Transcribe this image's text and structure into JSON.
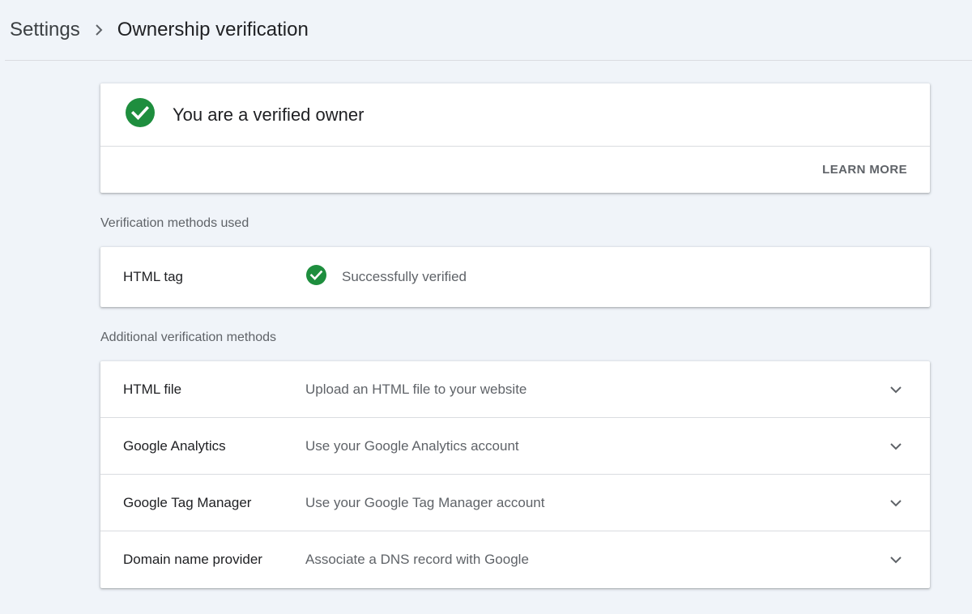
{
  "breadcrumb": {
    "parent": "Settings",
    "current": "Ownership verification"
  },
  "owner_card": {
    "title": "You are a verified owner",
    "action": "LEARN MORE"
  },
  "used_section": {
    "label": "Verification methods used",
    "methods": [
      {
        "name": "HTML tag",
        "status": "Successfully verified"
      }
    ]
  },
  "additional_section": {
    "label": "Additional verification methods",
    "methods": [
      {
        "name": "HTML file",
        "description": "Upload an HTML file to your website"
      },
      {
        "name": "Google Analytics",
        "description": "Use your Google Analytics account"
      },
      {
        "name": "Google Tag Manager",
        "description": "Use your Google Tag Manager account"
      },
      {
        "name": "Domain name provider",
        "description": "Associate a DNS record with Google"
      }
    ]
  },
  "icons": {
    "breadcrumb_separator": "chevron-right-icon",
    "verified": "check-circle-icon",
    "expand": "chevron-down-icon"
  },
  "colors": {
    "success_green": "#1e8e3e",
    "background": "#f0f4f9",
    "card": "#ffffff",
    "muted_text": "#5f6368"
  }
}
